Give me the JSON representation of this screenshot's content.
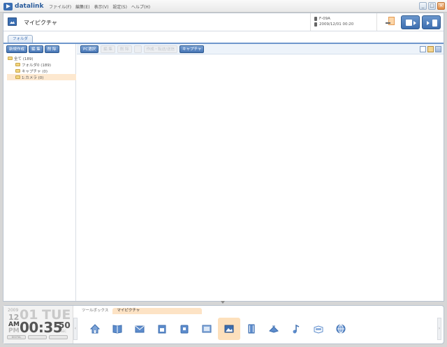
{
  "app": {
    "logo_text": "datalink",
    "menus": [
      "ファイル(F)",
      "編集(E)",
      "表示(V)",
      "設定(S)",
      "ヘルプ(H)"
    ],
    "window_controls": [
      "_",
      "□",
      "×"
    ]
  },
  "header": {
    "title": "マイピクチャ",
    "device_model": "F-09A",
    "device_datetime": "2009/12/01 00:20"
  },
  "left": {
    "tab_label": "フォルダ",
    "buttons": {
      "new": "新規作成",
      "edit": "編 集",
      "delete": "削 除"
    },
    "tree": [
      {
        "label": "全て (189)",
        "level": 0,
        "selected": false
      },
      {
        "label": "フォルダ0 (189)",
        "level": 1,
        "selected": false
      },
      {
        "label": "キャプチャ (0)",
        "level": 1,
        "selected": false
      },
      {
        "label": "1:カメラ (0)",
        "level": 1,
        "selected": true
      }
    ]
  },
  "main": {
    "buttons": {
      "pc_select": "PC選択",
      "edit": "編 集",
      "delete": "削 除",
      "convert_send": "作成・転送/送信",
      "capture": "キャプチャ"
    }
  },
  "clock": {
    "year": "2009",
    "month": "12",
    "day": "01",
    "weekday": "TUE",
    "am": "AM",
    "pm": "PM",
    "time": "00:35",
    "seconds": "50",
    "seconds_label": "SEC",
    "buttons": [
      "DIGITAL",
      "",
      ""
    ]
  },
  "dock": {
    "tabs": [
      "ツールボックス",
      "マイピクチャ"
    ],
    "icons": [
      "home-icon",
      "phonebook-icon",
      "mail-icon",
      "schedule-icon",
      "bookmark-icon",
      "screen-icon",
      "picture-icon",
      "movie-icon",
      "ringtone-icon",
      "music-icon",
      "pdf-icon",
      "globe-icon"
    ],
    "selected_icon": "picture-icon"
  },
  "colors": {
    "accent": "#3d6eaf",
    "selection": "#fde3c5"
  }
}
